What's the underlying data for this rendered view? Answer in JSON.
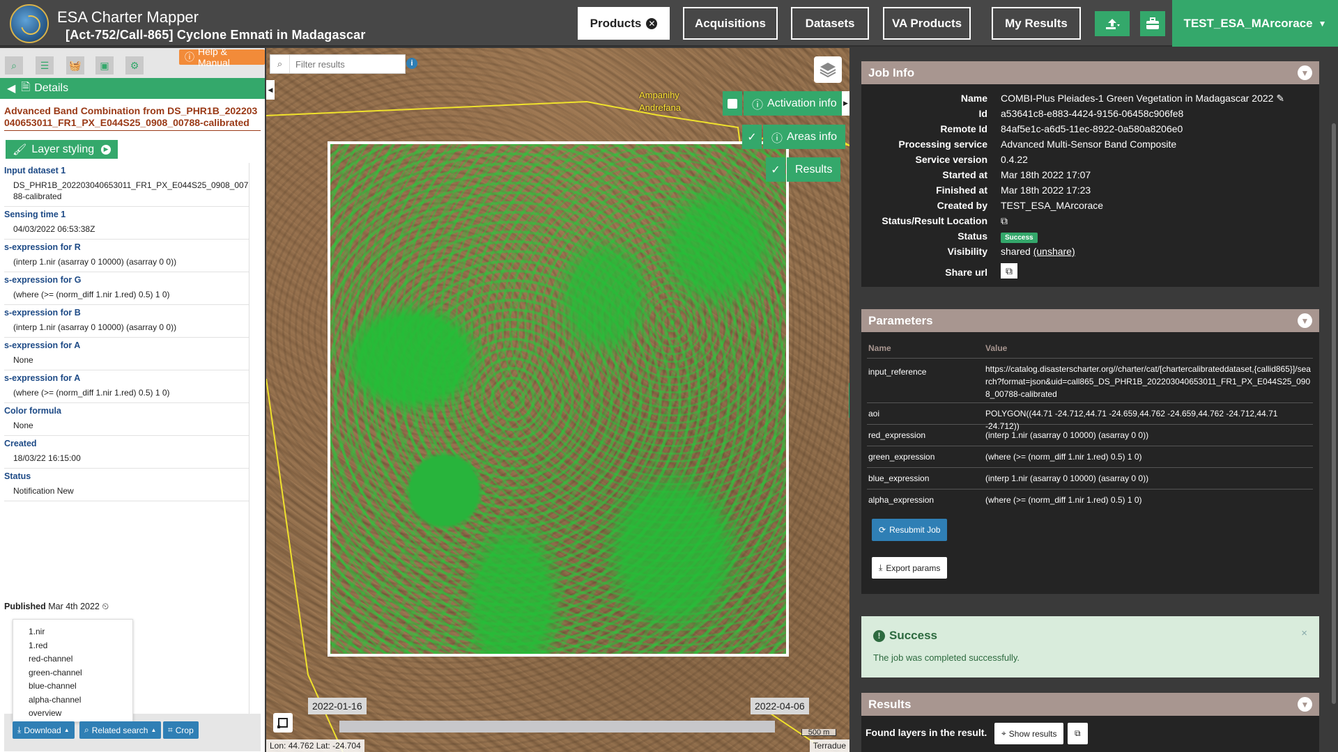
{
  "header": {
    "app_title": "ESA Charter Mapper",
    "subtitle": "[Act-752/Call-865] Cyclone Emnati in Madagascar",
    "nav": [
      {
        "label": "Products",
        "active": true,
        "badge": "✕"
      },
      {
        "label": "Acquisitions"
      },
      {
        "label": "Datasets"
      },
      {
        "label": "VA Products"
      },
      {
        "label": "My Results"
      }
    ],
    "user": "TEST_ESA_MArcorace"
  },
  "left": {
    "help_label": "Help & Manual",
    "details_label": "Details",
    "layer_title": "Advanced Band Combination from DS_PHR1B_202203040653011_FR1_PX_E044S25_0908_00788-calibrated",
    "styling_label": "Layer styling",
    "properties": [
      {
        "label": "Input dataset 1",
        "value": "DS_PHR1B_202203040653011_FR1_PX_E044S25_0908_00788-calibrated"
      },
      {
        "label": "Sensing time 1",
        "value": "04/03/2022 06:53:38Z"
      },
      {
        "label": "s-expression for R",
        "value": "(interp 1.nir (asarray 0 10000) (asarray 0 0))"
      },
      {
        "label": "s-expression for G",
        "value": "(where (>= (norm_diff 1.nir 1.red) 0.5) 1 0)"
      },
      {
        "label": "s-expression for B",
        "value": "(interp 1.nir (asarray 0 10000) (asarray 0 0))"
      },
      {
        "label": "s-expression for A",
        "value": "None"
      },
      {
        "label": "s-expression for A",
        "value": "(where (>= (norm_diff 1.nir 1.red) 0.5) 1 0)"
      },
      {
        "label": "Color formula",
        "value": "None"
      },
      {
        "label": "Created",
        "value": "18/03/22 16:15:00"
      },
      {
        "label": "Status",
        "value": "Notification New"
      }
    ],
    "published_label": "Published",
    "published_date": "Mar 4th 2022",
    "dropdown": [
      "1.nir",
      "1.red",
      "red-channel",
      "green-channel",
      "blue-channel",
      "alpha-channel",
      "overview"
    ],
    "actions": {
      "download": "Download",
      "related": "Related search",
      "crop": "Crop"
    }
  },
  "map": {
    "filter_placeholder": "Filter results",
    "overlays": {
      "activation": "Activation info",
      "areas": "Areas info",
      "results": "Results"
    },
    "places": [
      "Ampanihy",
      "Andrefana"
    ],
    "date_start": "2022-01-16",
    "date_end": "2022-04-06",
    "coords": "Lon: 44.762 Lat: -24.704",
    "scale": "500 m",
    "attribution": "Terradue"
  },
  "job_info": {
    "title": "Job Info",
    "rows": [
      {
        "k": "Name",
        "v": "COMBI-Plus Pleiades-1 Green Vegetation in Madagascar 2022"
      },
      {
        "k": "Id",
        "v": "a53641c8-e883-4424-9156-06458c906fe8"
      },
      {
        "k": "Remote Id",
        "v": "84af5e1c-a6d5-11ec-8922-0a580a8206e0"
      },
      {
        "k": "Processing service",
        "v": "Advanced Multi-Sensor Band Composite"
      },
      {
        "k": "Service version",
        "v": "0.4.22"
      },
      {
        "k": "Started at",
        "v": "Mar 18th 2022 17:07"
      },
      {
        "k": "Finished at",
        "v": "Mar 18th 2022 17:23"
      },
      {
        "k": "Created by",
        "v": "TEST_ESA_MArcorace"
      }
    ],
    "status_location_label": "Status/Result Location",
    "status_label": "Status",
    "status_value": "Success",
    "visibility_label": "Visibility",
    "visibility_value": "shared",
    "unshare_label": "(unshare)",
    "share_label": "Share url"
  },
  "parameters": {
    "title": "Parameters",
    "col_name": "Name",
    "col_value": "Value",
    "rows": [
      {
        "name": "input_reference",
        "value": "https://catalog.disasterscharter.org//charter/cat/[chartercalibrateddataset,{callid865}]/search?format=json&uid=call865_DS_PHR1B_202203040653011_FR1_PX_E044S25_0908_00788-calibrated"
      },
      {
        "name": "aoi",
        "value": "POLYGON((44.71 -24.712,44.71 -24.659,44.762 -24.659,44.762 -24.712,44.71 -24.712))"
      },
      {
        "name": "red_expression",
        "value": "(interp 1.nir (asarray 0 10000) (asarray 0 0))"
      },
      {
        "name": "green_expression",
        "value": "(where (>= (norm_diff 1.nir 1.red) 0.5) 1 0)"
      },
      {
        "name": "blue_expression",
        "value": "(interp 1.nir (asarray 0 10000) (asarray 0 0))"
      },
      {
        "name": "alpha_expression",
        "value": "(where (>= (norm_diff 1.nir 1.red) 0.5) 1 0)"
      }
    ],
    "resubmit_label": "Resubmit Job",
    "export_label": "Export params"
  },
  "success": {
    "title": "Success",
    "message": "The job was completed successfully."
  },
  "results": {
    "title": "Results",
    "found_label": "Found layers in the result.",
    "show_label": "Show results"
  }
}
